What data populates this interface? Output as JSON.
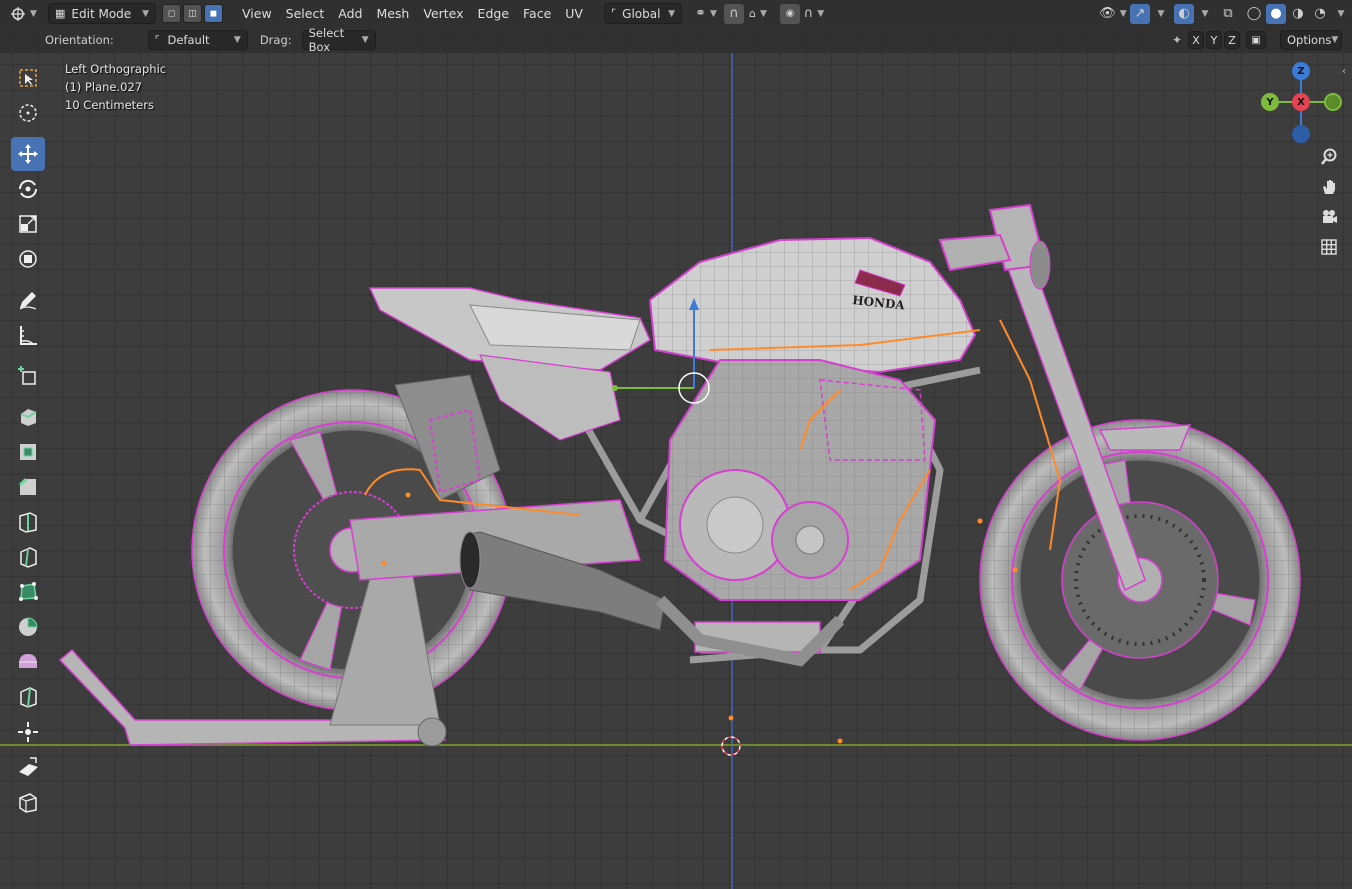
{
  "header": {
    "mode": "Edit Mode",
    "menus": [
      "View",
      "Select",
      "Add",
      "Mesh",
      "Vertex",
      "Edge",
      "Face",
      "UV"
    ],
    "transform_orientation": "Global"
  },
  "tool_header": {
    "orientation_label": "Orientation:",
    "orientation_value": "Default",
    "drag_label": "Drag:",
    "drag_value": "Select Box",
    "axes": [
      "X",
      "Y",
      "Z"
    ],
    "options_label": "Options"
  },
  "viewport": {
    "view_name": "Left Orthographic",
    "object_name": "(1) Plane.027",
    "grid_scale": "10 Centimeters",
    "brand_text": "HONDA"
  },
  "gizmo": {
    "z": "Z",
    "y": "Y",
    "x": "X"
  },
  "tools": [
    "select-box",
    "cursor",
    "move",
    "rotate",
    "scale",
    "transform",
    "annotate",
    "measure",
    "add-cube",
    "extrude",
    "inset",
    "bevel",
    "loop-cut",
    "knife",
    "poly-build",
    "spin",
    "smooth",
    "edge-slide",
    "shrink-fatten",
    "shear",
    "rip"
  ],
  "colors": {
    "accent": "#4772b3",
    "edit_wire": "#d63fd0",
    "selected": "#ff8a2a",
    "x_axis": "#e8414f",
    "y_axis": "#7dbb3b",
    "z_axis": "#3c7bd7"
  }
}
